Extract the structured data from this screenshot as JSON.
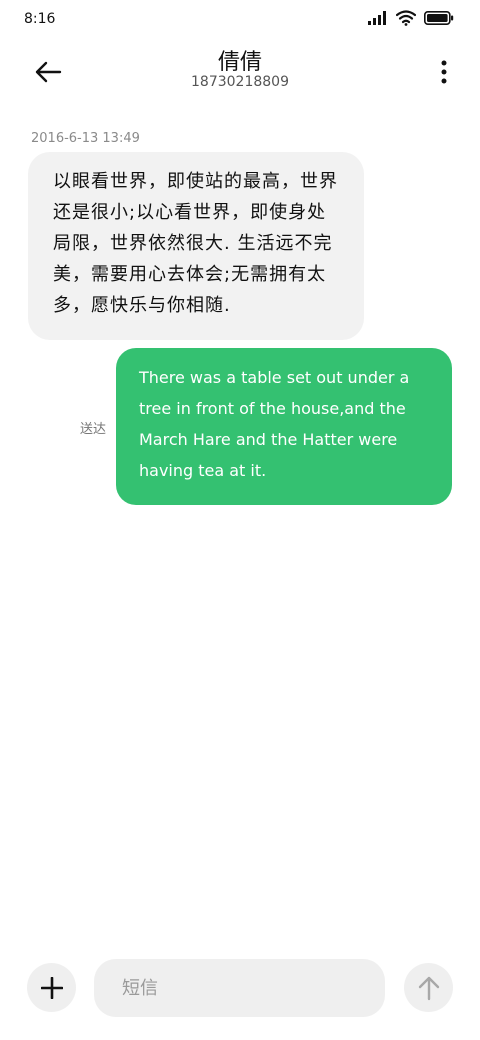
{
  "status_bar": {
    "time": "8:16",
    "icons": [
      "signal-icon",
      "wifi-icon",
      "battery-icon"
    ]
  },
  "header": {
    "back_icon": "arrow-left-icon",
    "contact_name": "倩倩",
    "contact_number": "18730218809",
    "more_icon": "more-vertical-icon"
  },
  "conversation": {
    "timestamp": "2016-6-13 13:49",
    "incoming_message": "以眼看世界，即使站的最高，世界还是很小;以心看世界，即使身处局限，世界依然很大. 生活远不完美，需要用心去体会;无需拥有太多，愿快乐与你相随.",
    "outgoing_message": "There was a table set out under a tree in front of the house,and the March Hare and the Hatter were having tea at it.",
    "delivered_label": "送达"
  },
  "composer": {
    "add_icon": "plus-icon",
    "placeholder": "短信",
    "value": "",
    "send_icon": "arrow-up-icon"
  },
  "colors": {
    "incoming_bubble": "#f2f2f2",
    "outgoing_bubble": "#34c171",
    "background": "#ffffff"
  }
}
